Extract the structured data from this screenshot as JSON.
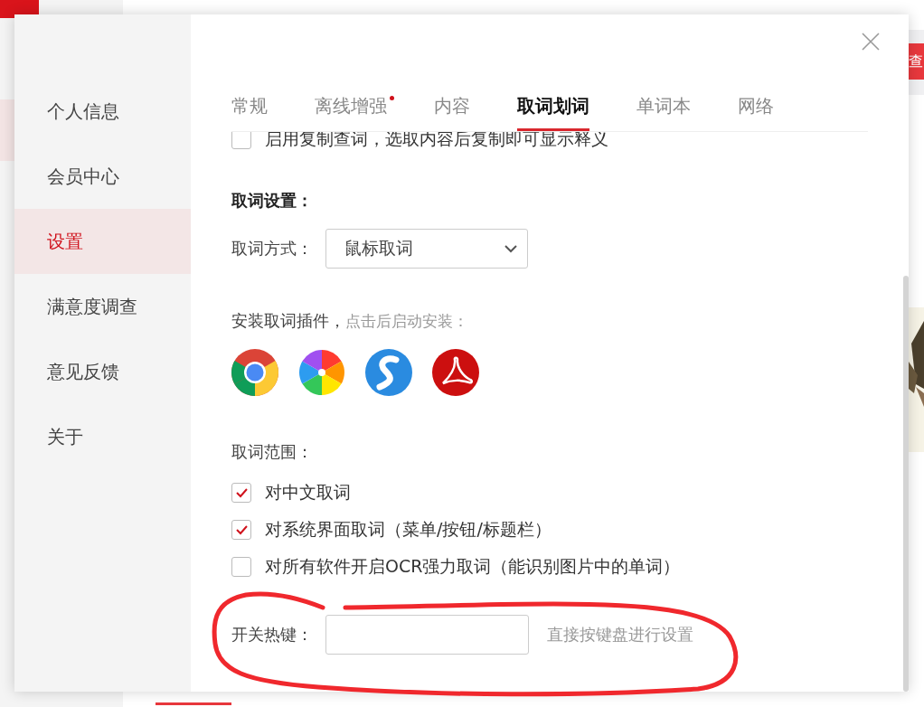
{
  "background": {
    "search_button": "查"
  },
  "sidebar": {
    "items": [
      {
        "label": "个人信息",
        "selected": false
      },
      {
        "label": "会员中心",
        "selected": false
      },
      {
        "label": "设置",
        "selected": true
      },
      {
        "label": "满意度调查",
        "selected": false
      },
      {
        "label": "意见反馈",
        "selected": false
      },
      {
        "label": "关于",
        "selected": false
      }
    ]
  },
  "tabs": [
    {
      "label": "常规",
      "selected": false,
      "badge": false
    },
    {
      "label": "离线增强",
      "selected": false,
      "badge": true
    },
    {
      "label": "内容",
      "selected": false,
      "badge": false
    },
    {
      "label": "取词划词",
      "selected": true,
      "badge": false
    },
    {
      "label": "单词本",
      "selected": false,
      "badge": false
    },
    {
      "label": "网络",
      "selected": false,
      "badge": false
    }
  ],
  "copy_lookup": {
    "label": "启用复制查词，选取内容后复制即可显示释义",
    "checked": false
  },
  "section_title": "取词设置：",
  "method": {
    "label": "取词方式：",
    "value": "鼠标取词"
  },
  "plugins": {
    "label": "安装取词插件，",
    "hint": "点击后启动安装：",
    "items": [
      {
        "kind": "chrome"
      },
      {
        "kind": "pinwheel"
      },
      {
        "kind": "s-ball"
      },
      {
        "kind": "acrobat"
      }
    ]
  },
  "range": {
    "label": "取词范围：",
    "options": [
      {
        "label": "对中文取词",
        "checked": true
      },
      {
        "label": "对系统界面取词（菜单/按钮/标题栏）",
        "checked": true
      },
      {
        "label": "对所有软件开启OCR强力取词（能识别图片中的单词）",
        "checked": false
      }
    ]
  },
  "hotkey": {
    "label": "开关热键：",
    "hint": "直接按键盘进行设置"
  }
}
